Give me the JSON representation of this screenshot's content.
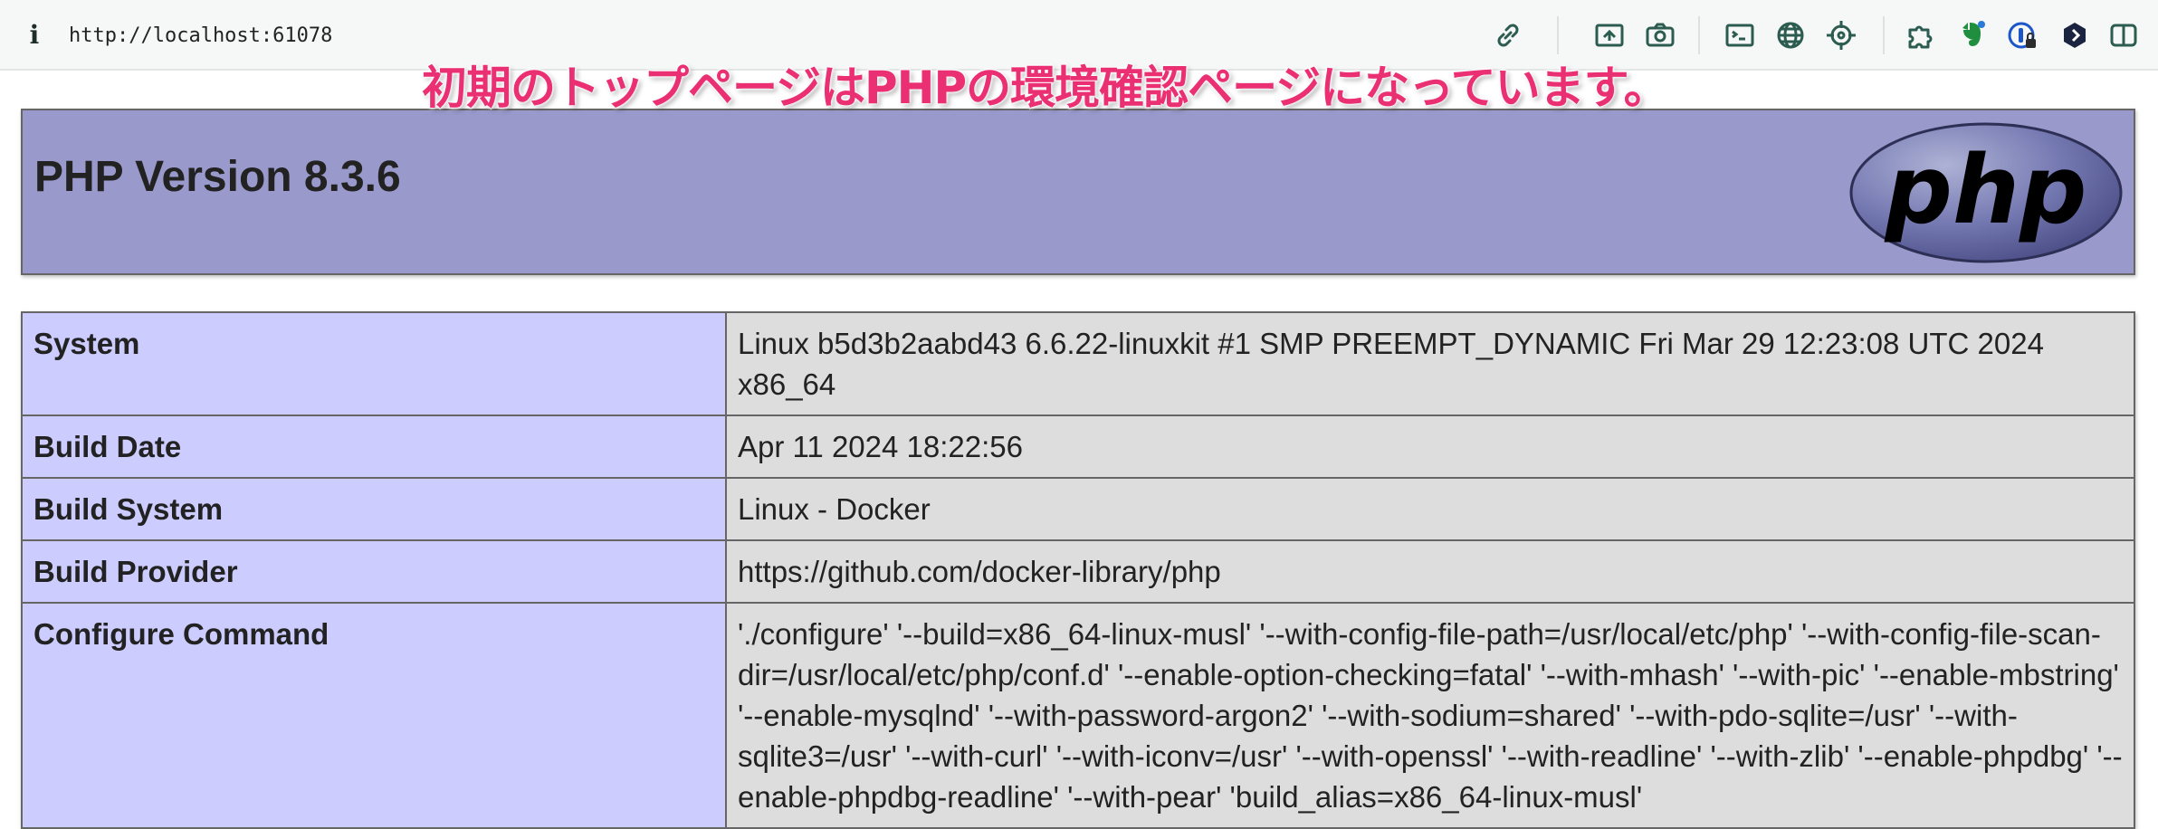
{
  "browser": {
    "info_glyph": "i",
    "url": "http://localhost:61078",
    "toolbar_icons": [
      "link-icon",
      "screenshot-frame-icon",
      "camera-icon",
      "terminal-icon",
      "globe-icon",
      "crosshair-icon",
      "puzzle-extension-icon",
      "evernote-icon",
      "password-manager-icon",
      "dark-extension-icon",
      "sidebar-toggle-icon"
    ]
  },
  "annotation": {
    "text": "初期のトップページはPHPの環境確認ページになっています。",
    "color": "#ea2f72"
  },
  "phpinfo": {
    "title": "PHP Version 8.3.6",
    "logo_text": "php",
    "rows": [
      {
        "key": "System",
        "value": "Linux b5d3b2aabd43 6.6.22-linuxkit #1 SMP PREEMPT_DYNAMIC Fri Mar 29 12:23:08 UTC 2024 x86_64"
      },
      {
        "key": "Build Date",
        "value": "Apr 11 2024 18:22:56"
      },
      {
        "key": "Build System",
        "value": "Linux - Docker"
      },
      {
        "key": "Build Provider",
        "value": "https://github.com/docker-library/php"
      },
      {
        "key": "Configure Command",
        "value": "'./configure' '--build=x86_64-linux-musl' '--with-config-file-path=/usr/local/etc/php' '--with-config-file-scan-dir=/usr/local/etc/php/conf.d' '--enable-option-checking=fatal' '--with-mhash' '--with-pic' '--enable-mbstring' '--enable-mysqlnd' '--with-password-argon2' '--with-sodium=shared' '--with-pdo-sqlite=/usr' '--with-sqlite3=/usr' '--with-curl' '--with-iconv=/usr' '--with-openssl' '--with-readline' '--with-zlib' '--enable-phpdbg' '--enable-phpdbg-readline' '--with-pear' 'build_alias=x86_64-linux-musl'"
      }
    ],
    "colors": {
      "header_bg": "#9999cc",
      "key_bg": "#ccccff",
      "value_bg": "#dddddd"
    }
  }
}
